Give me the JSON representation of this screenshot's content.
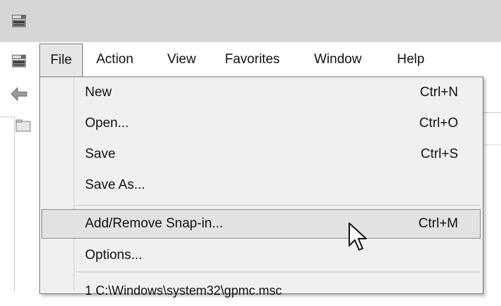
{
  "window": {
    "app_icon": "mmc-console-icon"
  },
  "menubar": {
    "items": [
      {
        "label": "File"
      },
      {
        "label": "Action"
      },
      {
        "label": "View"
      },
      {
        "label": "Favorites"
      },
      {
        "label": "Window"
      },
      {
        "label": "Help"
      }
    ]
  },
  "toolbar": {
    "back_icon": "back-arrow-icon"
  },
  "file_menu": {
    "items": [
      {
        "label": "New",
        "shortcut": "Ctrl+N"
      },
      {
        "label": "Open...",
        "shortcut": "Ctrl+O"
      },
      {
        "label": "Save",
        "shortcut": "Ctrl+S"
      },
      {
        "label": "Save As...",
        "shortcut": ""
      },
      {
        "label": "Add/Remove Snap-in...",
        "shortcut": "Ctrl+M",
        "highlighted": true
      },
      {
        "label": "Options...",
        "shortcut": ""
      },
      {
        "label": "1 C:\\Windows\\system32\\gpmc.msc",
        "shortcut": ""
      }
    ]
  },
  "colors": {
    "menu_bg": "#f0f0f0",
    "highlight_bg": "#e2e2e2",
    "titlebar_bg": "#d6d6d6"
  }
}
